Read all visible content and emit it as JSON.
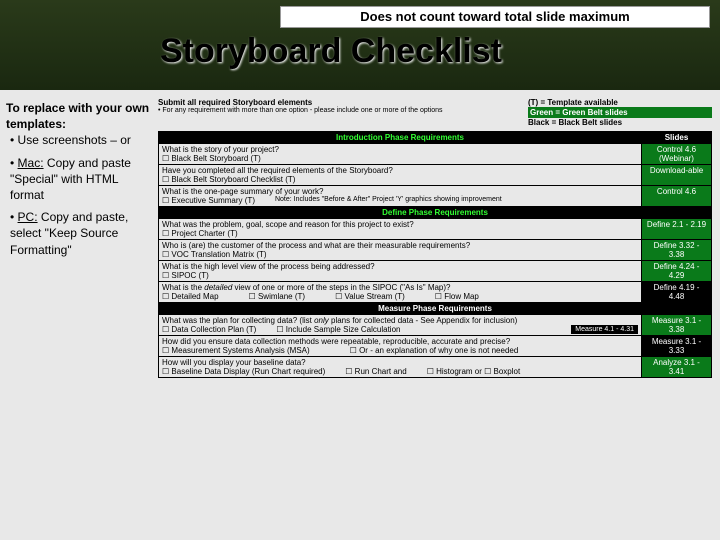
{
  "banner": "Does not count toward total slide maximum",
  "title": "Storyboard Checklist",
  "sidebar": {
    "heading": "To replace with your own templates:",
    "items": [
      {
        "text": "Use screenshots – or"
      },
      {
        "text_pre": "Mac:",
        "text": " Copy and paste \"Special\" with HTML format"
      },
      {
        "text_pre": "PC:",
        "text": " Copy and paste, select \"Keep Source Formatting\""
      }
    ]
  },
  "notes": {
    "left1": "Submit all required Storyboard elements",
    "left2": "• For any requirement with more than one option - please include one or more of the options",
    "right1": "(T) = Template available",
    "right2": "Green = Green Belt slides",
    "right3": "Black = Black Belt slides"
  },
  "intro": {
    "phase": "Introduction Phase Requirements",
    "slides_h": "Slides",
    "rows": [
      {
        "q": "What is the story of your project?",
        "sub": "Black Belt Storyboard (T)",
        "slide": "Control 4.6 (Webinar)",
        "cls": "g"
      },
      {
        "q": "Have you completed all the required elements of the Storyboard?",
        "sub": "Black Belt Storyboard Checklist (T)",
        "slide": "Download-able",
        "cls": "g"
      },
      {
        "q": "What is the one-page summary of your work?",
        "sub": "Executive Summary (T)",
        "note": "Note: Includes \"Before & After\" Project 'Y' graphics showing improvement",
        "slide": "Control 4.6",
        "cls": "g"
      }
    ]
  },
  "define": {
    "phase": "Define Phase Requirements",
    "rows": [
      {
        "q": "What was the problem, goal, scope and reason for this project to exist?",
        "sub": "Project Charter (T)",
        "slide": "Define 2.1 - 2.19",
        "cls": "g"
      },
      {
        "q": "Who is (are) the customer of the process and what are their measurable requirements?",
        "sub": "VOC Translation Matrix (T)",
        "slide": "Define 3.32 - 3.38",
        "cls": "g"
      },
      {
        "q": "What is the high level view of the process being addressed?",
        "sub": "SIPOC (T)",
        "slide": "Define 4.24 - 4.29",
        "cls": "g"
      },
      {
        "q": "What is the detailed view of one or more of the steps in the SIPOC (\"As Is\" Map)?",
        "subs": [
          "Detailed Map",
          "Swimlane (T)",
          "Value Stream (T)",
          "Flow Map"
        ],
        "slide": "Define 4.19 - 4.48",
        "cls": "k"
      }
    ]
  },
  "measure": {
    "phase": "Measure Phase Requirements",
    "rows": [
      {
        "q": "What was the plan for collecting data? (list only plans for collected data - See Appendix for inclusion)",
        "subs": [
          "Data Collection Plan (T)",
          "Include Sample Size Calculation"
        ],
        "extra": "Measure 4.1 - 4.31",
        "slide": "Measure 3.1 - 3.38",
        "cls": "g"
      },
      {
        "q": "How did you ensure data collection methods were repeatable, reproducible, accurate and precise?",
        "subs": [
          "Measurement Systems Analysis (MSA)",
          "Or - an explanation of why one is not needed"
        ],
        "slide": "Measure 3.1 - 3.33",
        "cls": "k"
      },
      {
        "q": "How will you display your baseline data?",
        "subs": [
          "Baseline Data Display (Run Chart required)",
          "Run Chart and",
          "Histogram or ☐ Boxplot"
        ],
        "slide": "Analyze 3.1 - 3.41",
        "cls": "g"
      }
    ]
  }
}
